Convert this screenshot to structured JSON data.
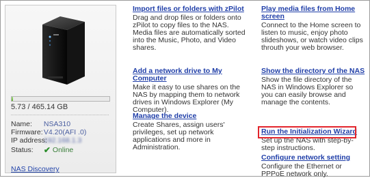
{
  "device": {
    "storage_text": "5.73 / 465.14 GB",
    "storage_used_fraction": 0.012,
    "name_label": "Name:",
    "name_value": "NSA310",
    "firmware_label": "Firmware:",
    "firmware_value": "V4.20(AFI .0)",
    "ip_label": "IP address:",
    "ip_value": "192.168.1.3",
    "status_label": "Status:",
    "status_value": "Online",
    "discovery_link": "NAS Discovery"
  },
  "actions": {
    "import": {
      "title": "Import files or folders with zPilot",
      "desc": "Drag and drop files or folders onto zPilot to copy files to the NAS. Media files are automatically sorted into the Music, Photo, and Video shares."
    },
    "add_drive": {
      "title": "Add a network drive to My Computer",
      "desc": "Make it easy to use shares on the NAS by mapping them to network drives in Windows Explorer (My Computer)."
    },
    "manage": {
      "title": "Manage the device",
      "desc": "Create Shares, assign users' privileges, set up network applications and more in Administration."
    },
    "play_media": {
      "title": "Play media files from Home screen",
      "desc": "Connect to the Home screen to listen to music, enjoy photo slideshows, or watch video clips throuth your web browser."
    },
    "show_dir": {
      "title": "Show the directory of the NAS",
      "desc": "Show the file directory of the NAS in Windows Explorer so you can easily browse and manage the contents."
    },
    "wizard": {
      "title": "Run the Initialization Wizard",
      "desc": "Set up the NAS with step-by-step instructions."
    },
    "network": {
      "title": "Configure network setting",
      "desc": "Configure the Ethernet or PPPoE network only."
    }
  },
  "colors": {
    "link": "#1f3ea8",
    "highlight": "#e2242b",
    "online": "#2b8d2b"
  }
}
